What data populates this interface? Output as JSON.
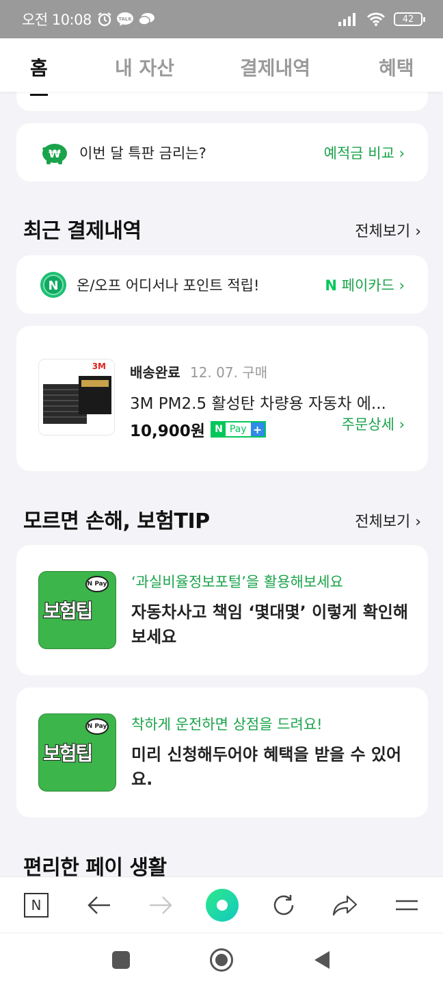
{
  "status_bar": {
    "ampm": "오전",
    "time": "10:08",
    "talk_label": "TALK",
    "battery": "42"
  },
  "tabs": [
    {
      "label": "홈",
      "active": true
    },
    {
      "label": "내 자산",
      "active": false
    },
    {
      "label": "결제내역",
      "active": false
    },
    {
      "label": "혜택",
      "active": false
    }
  ],
  "rate_banner": {
    "text": "이번 달 특판 금리는?",
    "link": "예적금 비교"
  },
  "recent_payments": {
    "title": "최근 결제내역",
    "more": "전체보기",
    "card_banner": {
      "text": "온/오프 어디서나 포인트 적립!",
      "link_brand": "N",
      "link": "페이카드"
    },
    "order": {
      "status": "배송완료",
      "date": "12. 07. 구매",
      "product": "3M PM2.5 활성탄 차량용 자동차 에...",
      "price": "10,900원",
      "pay_label": "Pay",
      "pay_n": "N",
      "detail_link": "주문상세",
      "brand_logo": "3M"
    }
  },
  "insurance_tips": {
    "title": "모르면 손해, 보험TIP",
    "more": "전체보기",
    "thumb_text": "보험팁",
    "thumb_badge": "N Pay",
    "items": [
      {
        "subtitle": "‘과실비율정보포털’을 활용해보세요",
        "title": "자동차사고 책임 ‘몇대몇’ 이렇게 확인해보세요"
      },
      {
        "subtitle": "착하게 운전하면 상점을 드려요!",
        "title": "미리 신청해두어야 혜택을 받을 수 있어요."
      }
    ]
  },
  "convenient_pay": {
    "title": "편리한 페이 생활"
  },
  "browser_bar": {
    "home_letter": "N"
  },
  "colors": {
    "accent_green": "#1aa34a",
    "npay_green": "#03c75a"
  }
}
